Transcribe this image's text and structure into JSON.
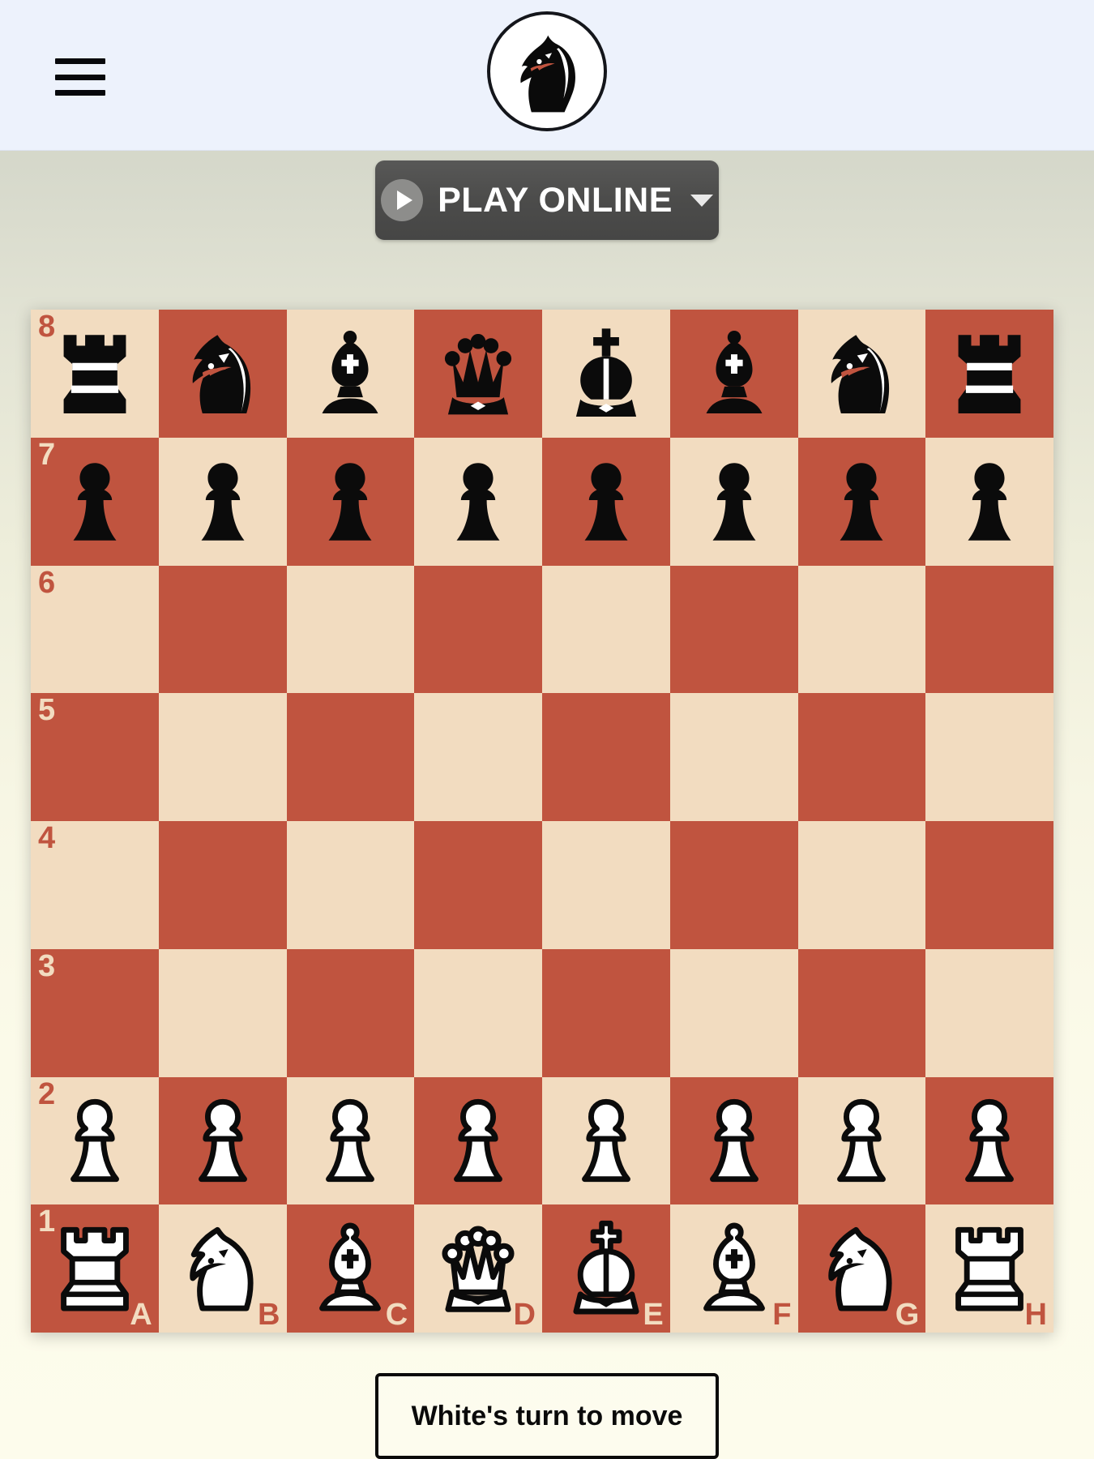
{
  "header": {
    "menu_icon": "hamburger-menu-icon",
    "logo_icon": "knight-head-logo-icon",
    "logo_alt": "Chess Knight Logo"
  },
  "toolbar": {
    "play_online_label": "PLAY ONLINE",
    "play_icon": "play-circle-icon",
    "dropdown_icon": "caret-down-icon"
  },
  "board": {
    "light_square_color": "#f2dcc0",
    "dark_square_color": "#c0543f",
    "orientation": "white-bottom",
    "rank_labels": [
      "8",
      "7",
      "6",
      "5",
      "4",
      "3",
      "2",
      "1"
    ],
    "file_labels": [
      "A",
      "B",
      "C",
      "D",
      "E",
      "F",
      "G",
      "H"
    ],
    "position_fen": "rnbqkbnr/pppppppp/8/8/8/8/PPPPPPPP/RNBQKBNR",
    "rows": [
      {
        "rank": "8",
        "pieces": [
          "black-rook",
          "black-knight",
          "black-bishop",
          "black-queen",
          "black-king",
          "black-bishop",
          "black-knight",
          "black-rook"
        ]
      },
      {
        "rank": "7",
        "pieces": [
          "black-pawn",
          "black-pawn",
          "black-pawn",
          "black-pawn",
          "black-pawn",
          "black-pawn",
          "black-pawn",
          "black-pawn"
        ]
      },
      {
        "rank": "6",
        "pieces": [
          "",
          "",
          "",
          "",
          "",
          "",
          "",
          ""
        ]
      },
      {
        "rank": "5",
        "pieces": [
          "",
          "",
          "",
          "",
          "",
          "",
          "",
          ""
        ]
      },
      {
        "rank": "4",
        "pieces": [
          "",
          "",
          "",
          "",
          "",
          "",
          "",
          ""
        ]
      },
      {
        "rank": "3",
        "pieces": [
          "",
          "",
          "",
          "",
          "",
          "",
          "",
          ""
        ]
      },
      {
        "rank": "2",
        "pieces": [
          "white-pawn",
          "white-pawn",
          "white-pawn",
          "white-pawn",
          "white-pawn",
          "white-pawn",
          "white-pawn",
          "white-pawn"
        ]
      },
      {
        "rank": "1",
        "pieces": [
          "white-rook",
          "white-knight",
          "white-bishop",
          "white-queen",
          "white-king",
          "white-bishop",
          "white-knight",
          "white-rook"
        ]
      }
    ]
  },
  "status": {
    "turn_text": "White's turn to move"
  }
}
